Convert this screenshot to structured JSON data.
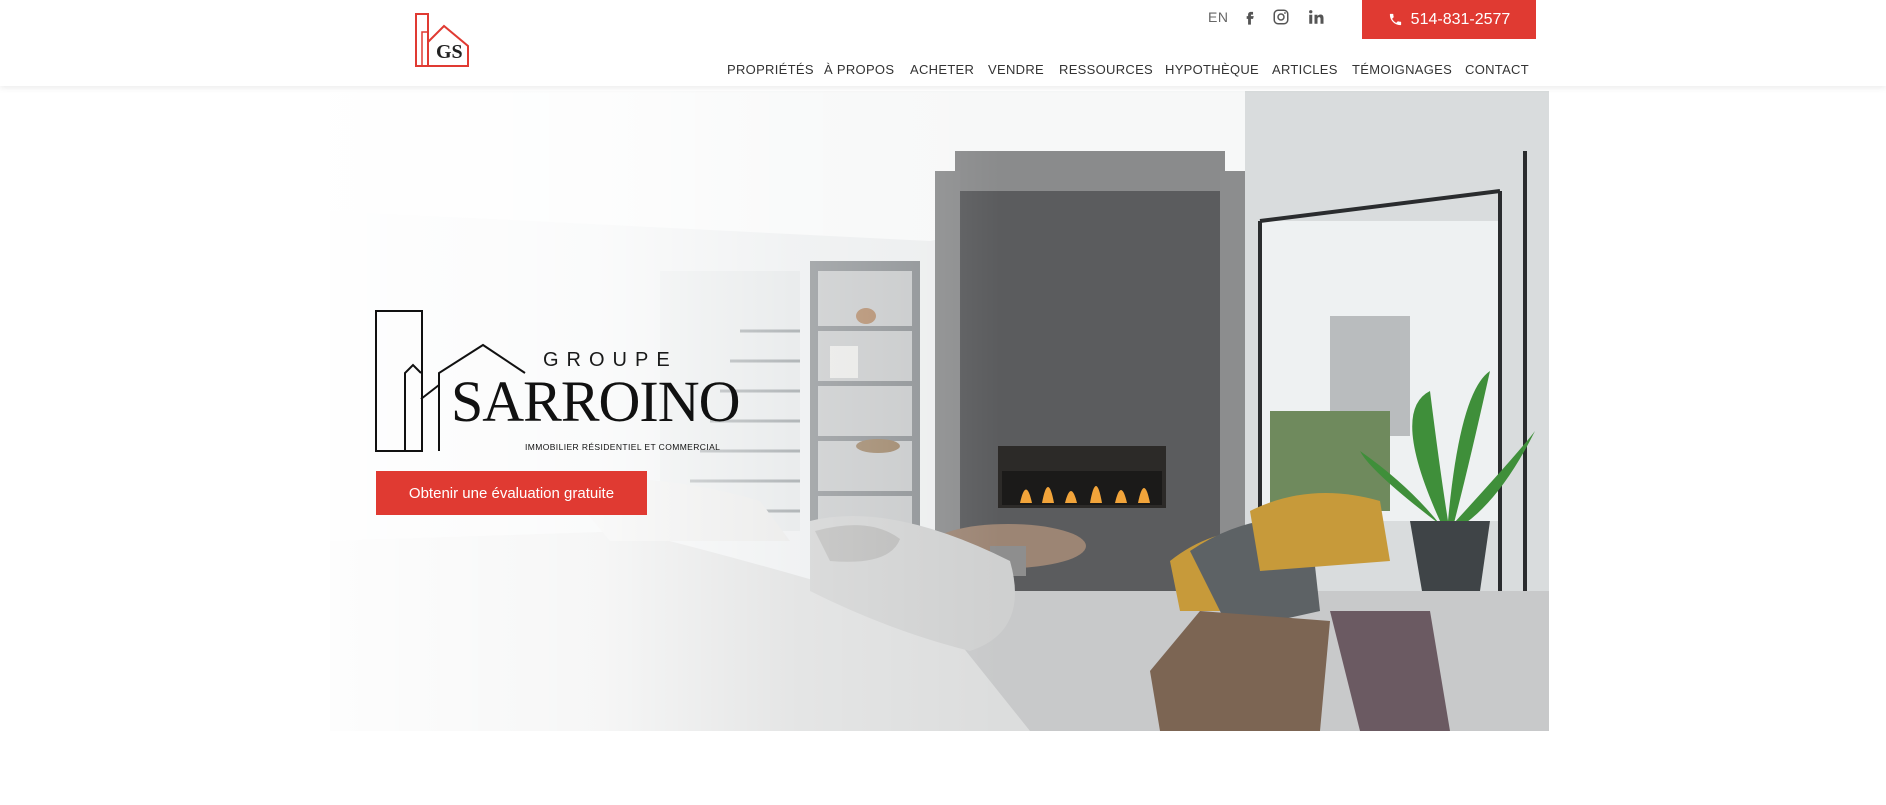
{
  "header": {
    "logo_text": "GS",
    "lang": "EN",
    "social": [
      "facebook-icon",
      "instagram-icon",
      "linkedin-icon"
    ],
    "phone_label": "514-831-2577",
    "nav": [
      "PROPRIÉTÉS",
      "À PROPOS",
      "ACHETER",
      "VENDRE",
      "RESSOURCES",
      "HYPOTHÈQUE",
      "ARTICLES",
      "TÉMOIGNAGES",
      "CONTACT"
    ]
  },
  "hero": {
    "brand_groupe": "GROUPE",
    "brand_name": "SARROINO",
    "brand_tagline": "IMMOBILIER RÉSIDENTIEL ET COMMERCIAL",
    "cta_label": "Obtenir une évaluation gratuite"
  },
  "colors": {
    "accent": "#e03a32",
    "nav_text": "#333333"
  }
}
